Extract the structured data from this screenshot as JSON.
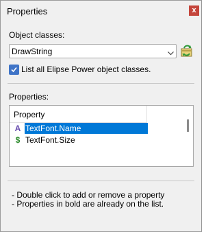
{
  "window": {
    "title": "Properties",
    "close_label": "x"
  },
  "object_classes": {
    "label": "Object classes:",
    "selected": "DrawString"
  },
  "list_all_checkbox": {
    "label": "List all Elipse Power object classes.",
    "checked": true
  },
  "properties": {
    "label": "Properties:",
    "column_header": "Property",
    "rows": [
      {
        "icon": "text-font-icon",
        "icon_glyph": "A",
        "name": "TextFont.Name",
        "selected": true
      },
      {
        "icon": "dollar-icon",
        "icon_glyph": "$",
        "name": "TextFont.Size",
        "selected": false
      }
    ]
  },
  "hints": [
    "- Double click to add or remove a property",
    "- Properties in bold are already on the list."
  ],
  "colors": {
    "close_button": "#c4453b",
    "selection": "#0078d7",
    "checkbox": "#3f74c7",
    "text_icon": "#6a4fb0",
    "dollar_icon": "#2e8b2e"
  }
}
